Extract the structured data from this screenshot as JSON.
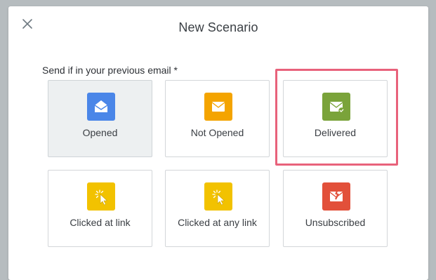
{
  "modal": {
    "title": "New Scenario",
    "section_label": "Send if in your previous email *"
  },
  "cards": [
    {
      "label": "Opened",
      "icon": "envelope-open-icon",
      "color": "#4a86e8",
      "selected": true
    },
    {
      "label": "Not Opened",
      "icon": "envelope-closed-icon",
      "color": "#f4a400",
      "selected": false
    },
    {
      "label": "Delivered",
      "icon": "envelope-delivered-icon",
      "color": "#7aa33a",
      "selected": false
    },
    {
      "label": "Clicked at link",
      "icon": "cursor-click-icon",
      "color": "#f2c200",
      "selected": false
    },
    {
      "label": "Clicked at any link",
      "icon": "cursor-click-icon",
      "color": "#f2c200",
      "selected": false
    },
    {
      "label": "Unsubscribed",
      "icon": "envelope-unsubscribe-icon",
      "color": "#e2503a",
      "selected": false
    }
  ],
  "highlight_color": "#e8627b"
}
